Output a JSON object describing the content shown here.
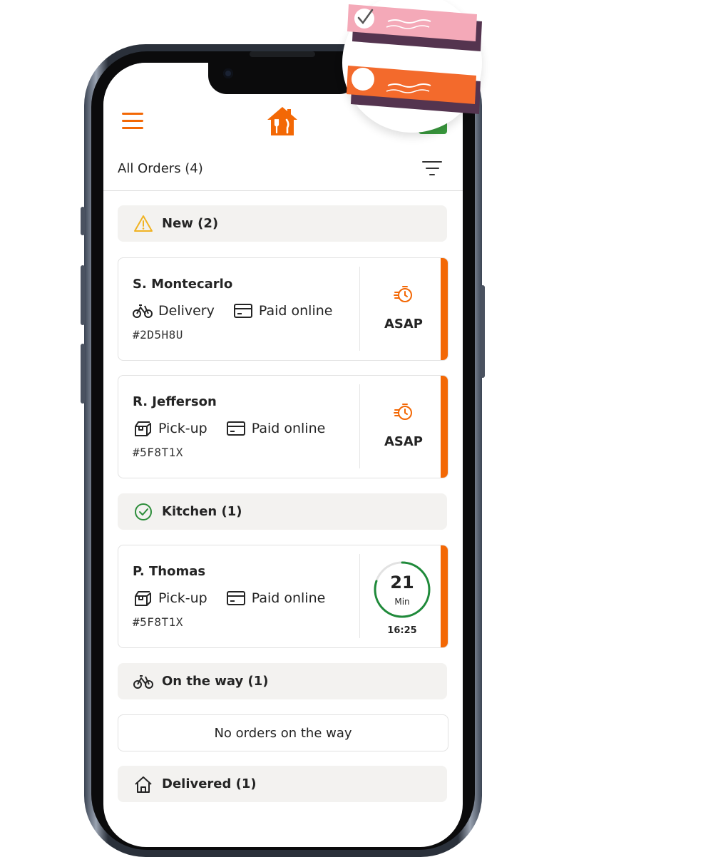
{
  "header": {
    "menu_icon": "hamburger-menu-icon",
    "logo_icon": "house-fork-knife-logo-icon",
    "accent_color": "#f36805"
  },
  "orders_bar": {
    "title": "All Orders (4)",
    "filter_icon": "filter-icon"
  },
  "sections": {
    "new": {
      "label": "New (2)",
      "icon": "warning-triangle-icon"
    },
    "kitchen": {
      "label": "Kitchen (1)",
      "icon": "check-circle-icon"
    },
    "on_the_way": {
      "label": "On the way (1)",
      "icon": "bicycle-icon"
    },
    "delivered": {
      "label": "Delivered (1)",
      "icon": "house-icon"
    }
  },
  "orders": [
    {
      "name": "S. Montecarlo",
      "type": "Delivery",
      "type_icon": "bicycle-icon",
      "payment": "Paid online",
      "payment_icon": "card-icon",
      "code": "#2D5H8U",
      "time_label": "ASAP"
    },
    {
      "name": "R. Jefferson",
      "type": "Pick-up",
      "type_icon": "box-icon",
      "payment": "Paid online",
      "payment_icon": "card-icon",
      "code": "#5F8T1X",
      "time_label": "ASAP"
    },
    {
      "name": "P. Thomas",
      "type": "Pick-up",
      "type_icon": "box-icon",
      "payment": "Paid online",
      "payment_icon": "card-icon",
      "code": "#5F8T1X",
      "minutes": "21",
      "minutes_unit": "Min",
      "clock": "16:25",
      "progress": 0.8
    }
  ],
  "empty_state": {
    "on_the_way": "No orders on the way"
  }
}
